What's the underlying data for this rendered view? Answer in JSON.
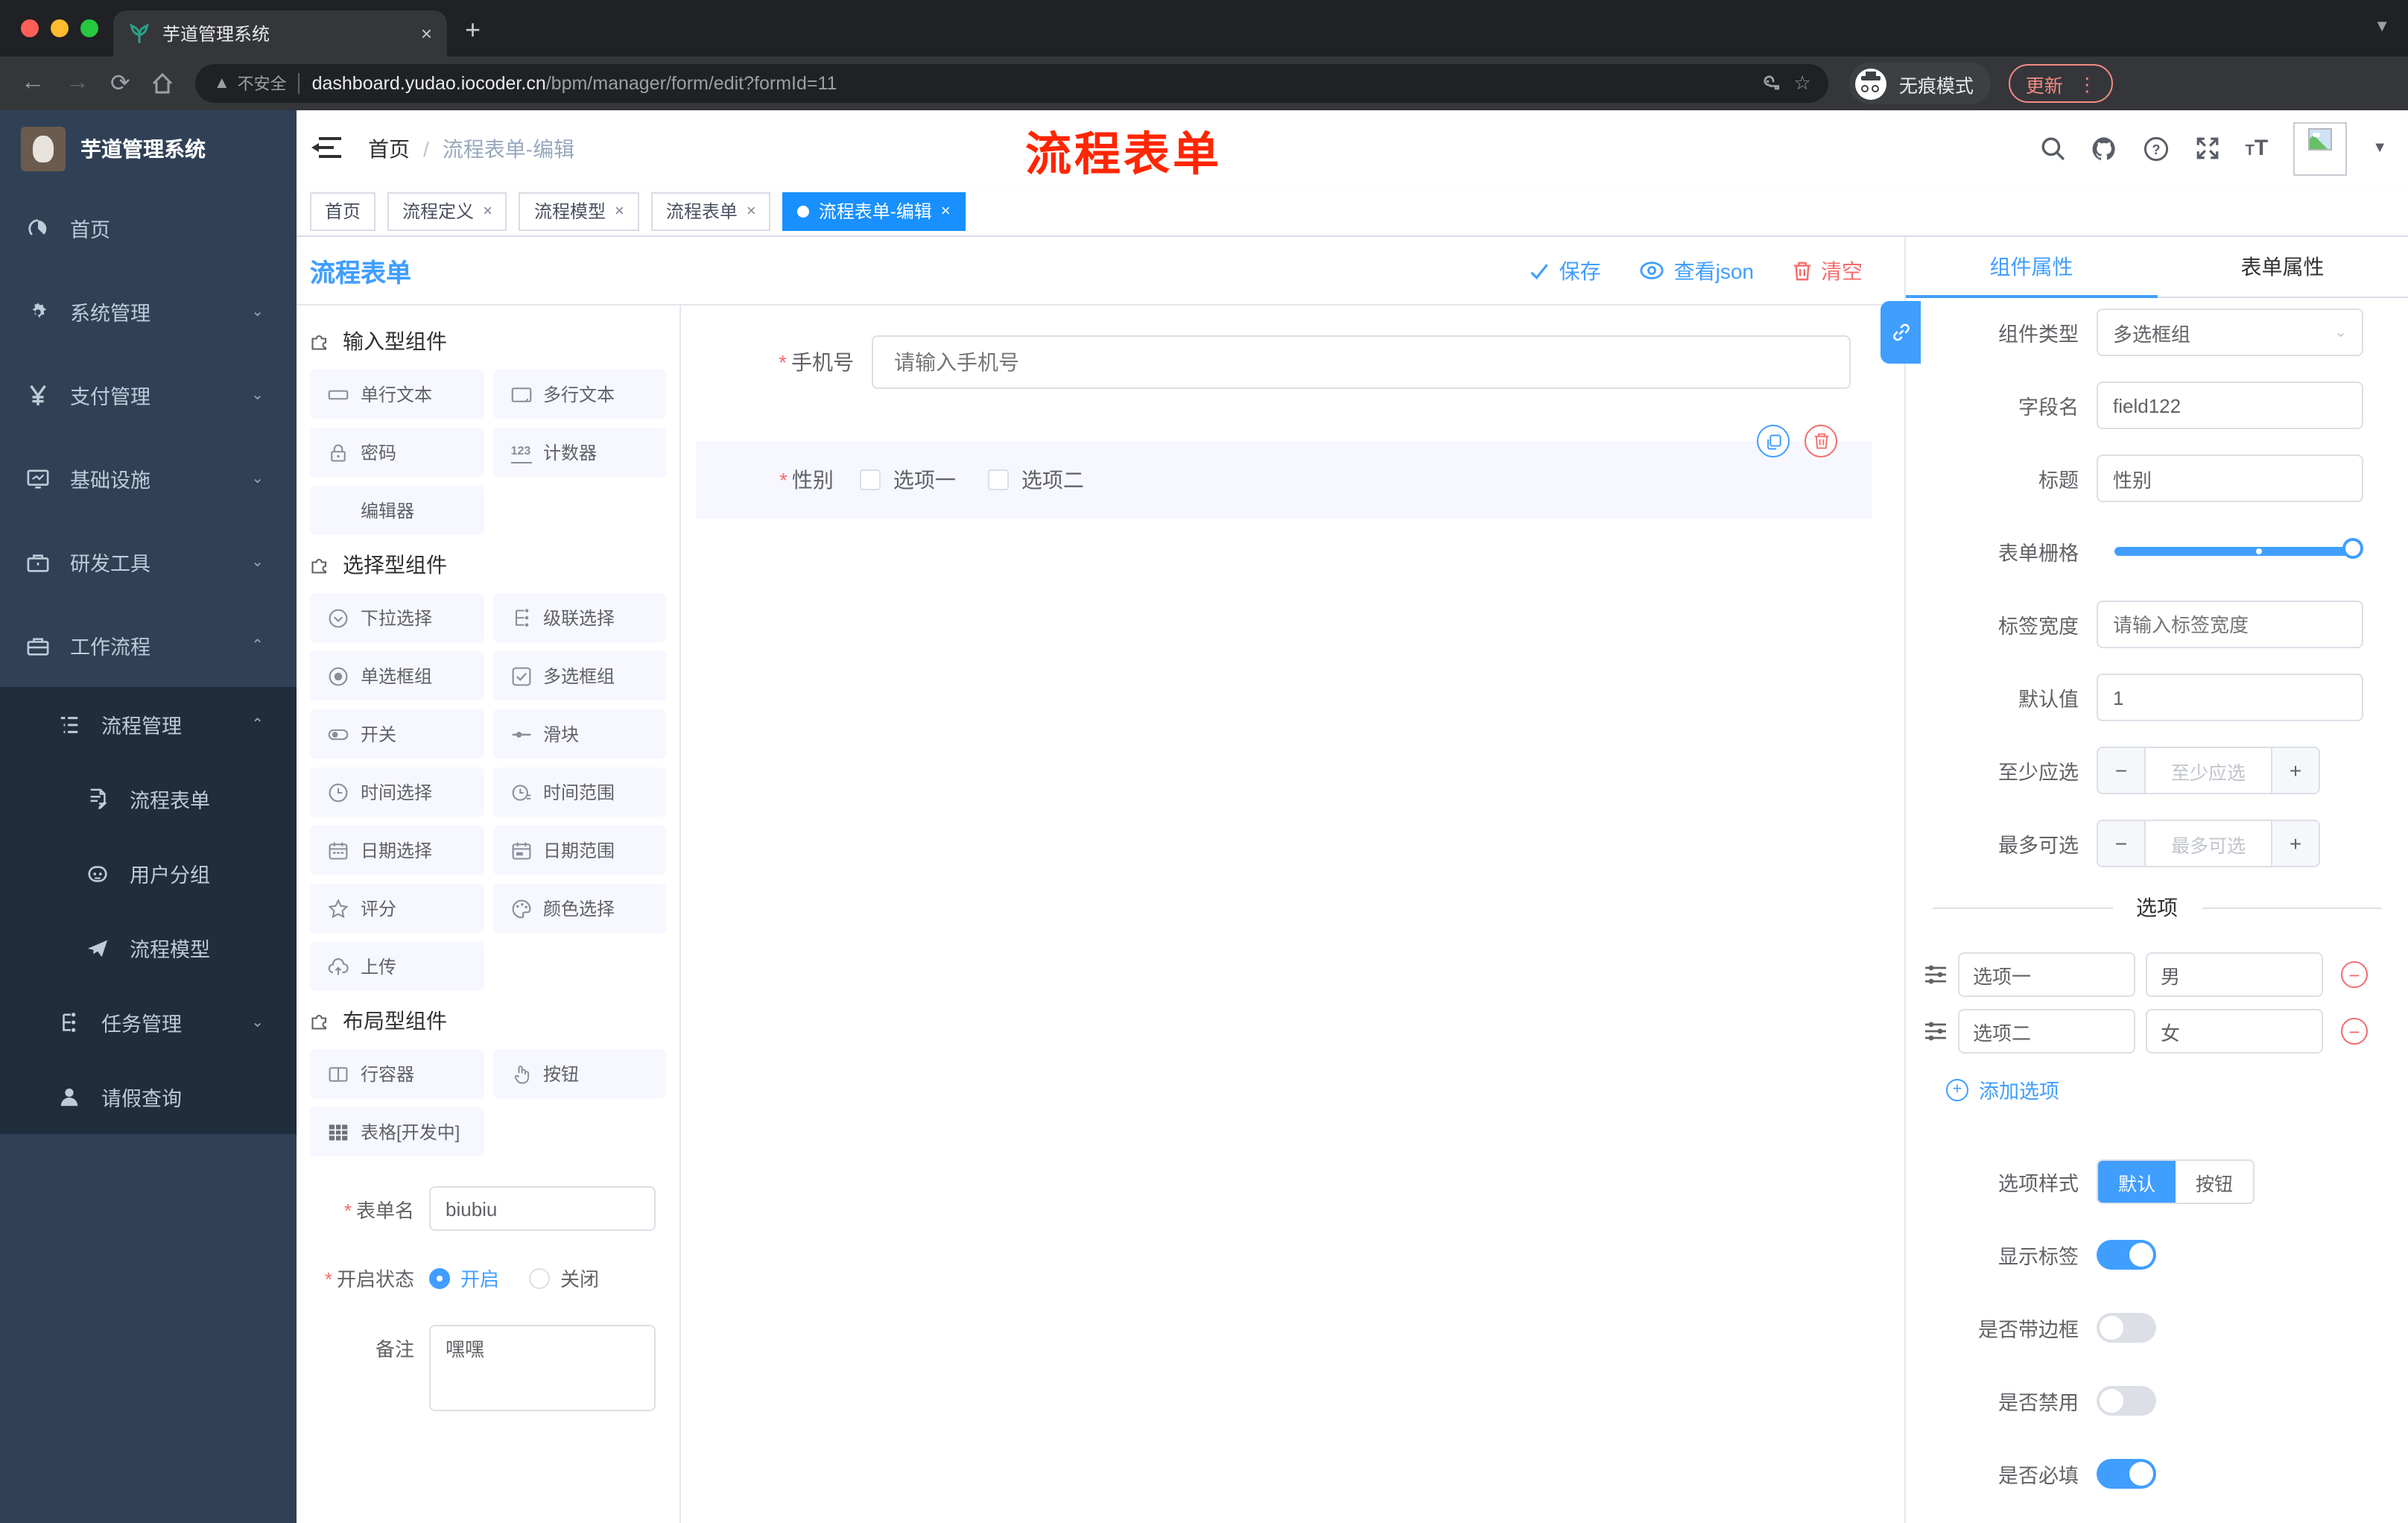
{
  "browser": {
    "tab_title": "芋道管理系统",
    "close_tab": "×",
    "new_tab": "+",
    "not_secure": "不安全",
    "url_host": "dashboard.yudao.iocoder.cn",
    "url_path": "/bpm/manager/form/edit?formId=11",
    "incognito": "无痕模式",
    "update": "更新",
    "menu_dots": "⋮"
  },
  "sidebar": {
    "brand": "芋道管理系统",
    "items": [
      {
        "label": "首页"
      },
      {
        "label": "系统管理"
      },
      {
        "label": "支付管理"
      },
      {
        "label": "基础设施"
      },
      {
        "label": "研发工具"
      },
      {
        "label": "工作流程"
      },
      {
        "label": "流程管理"
      },
      {
        "label": "流程表单"
      },
      {
        "label": "用户分组"
      },
      {
        "label": "流程模型"
      },
      {
        "label": "任务管理"
      },
      {
        "label": "请假查询"
      }
    ]
  },
  "header": {
    "breadcrumb_home": "首页",
    "breadcrumb_sep": "/",
    "breadcrumb_current": "流程表单-编辑",
    "annotation": "流程表单"
  },
  "tabbar": {
    "tabs": [
      {
        "label": "首页",
        "closable": false,
        "active": false
      },
      {
        "label": "流程定义",
        "closable": true,
        "active": false
      },
      {
        "label": "流程模型",
        "closable": true,
        "active": false
      },
      {
        "label": "流程表单",
        "closable": true,
        "active": false
      },
      {
        "label": "流程表单-编辑",
        "closable": true,
        "active": true
      }
    ]
  },
  "toolbar": {
    "title": "流程表单",
    "save": "保存",
    "view_json": "查看json",
    "clear": "清空"
  },
  "palette": {
    "input_section": "输入型组件",
    "input_items": [
      "单行文本",
      "多行文本",
      "密码",
      "计数器",
      "编辑器"
    ],
    "select_section": "选择型组件",
    "select_items": [
      "下拉选择",
      "级联选择",
      "单选框组",
      "多选框组",
      "开关",
      "滑块",
      "时间选择",
      "时间范围",
      "日期选择",
      "日期范围",
      "评分",
      "颜色选择",
      "上传"
    ],
    "layout_section": "布局型组件",
    "layout_items": [
      "行容器",
      "按钮",
      "表格[开发中]"
    ]
  },
  "form_meta": {
    "form_name_label": "表单名",
    "form_name_value": "biubiu",
    "status_label": "开启状态",
    "status_on": "开启",
    "status_off": "关闭",
    "remark_label": "备注",
    "remark_value": "嘿嘿"
  },
  "canvas": {
    "phone_label": "手机号",
    "phone_placeholder": "请输入手机号",
    "gender_label": "性别",
    "option1": "选项一",
    "option2": "选项二"
  },
  "props": {
    "tab_component": "组件属性",
    "tab_form": "表单属性",
    "type_label": "组件类型",
    "type_value": "多选框组",
    "field_label": "字段名",
    "field_value": "field122",
    "title_label": "标题",
    "title_value": "性别",
    "grid_label": "表单栅格",
    "label_width_label": "标签宽度",
    "label_width_placeholder": "请输入标签宽度",
    "default_label": "默认值",
    "default_value": "1",
    "min_label": "至少应选",
    "min_placeholder": "至少应选",
    "max_label": "最多可选",
    "max_placeholder": "最多可选",
    "options_divider": "选项",
    "options": [
      {
        "label": "选项一",
        "value": "男"
      },
      {
        "label": "选项二",
        "value": "女"
      }
    ],
    "add_option": "添加选项",
    "style_label": "选项样式",
    "style_default": "默认",
    "style_button": "按钮",
    "show_label": "显示标签",
    "border_label": "是否带边框",
    "disabled_label": "是否禁用",
    "required_label": "是否必填"
  },
  "colors": {
    "accent": "#409eff",
    "danger": "#f56c6c",
    "sidebar_bg": "#304156",
    "submenu_bg": "#1f2d3d",
    "annotation_red": "#ff2600"
  }
}
